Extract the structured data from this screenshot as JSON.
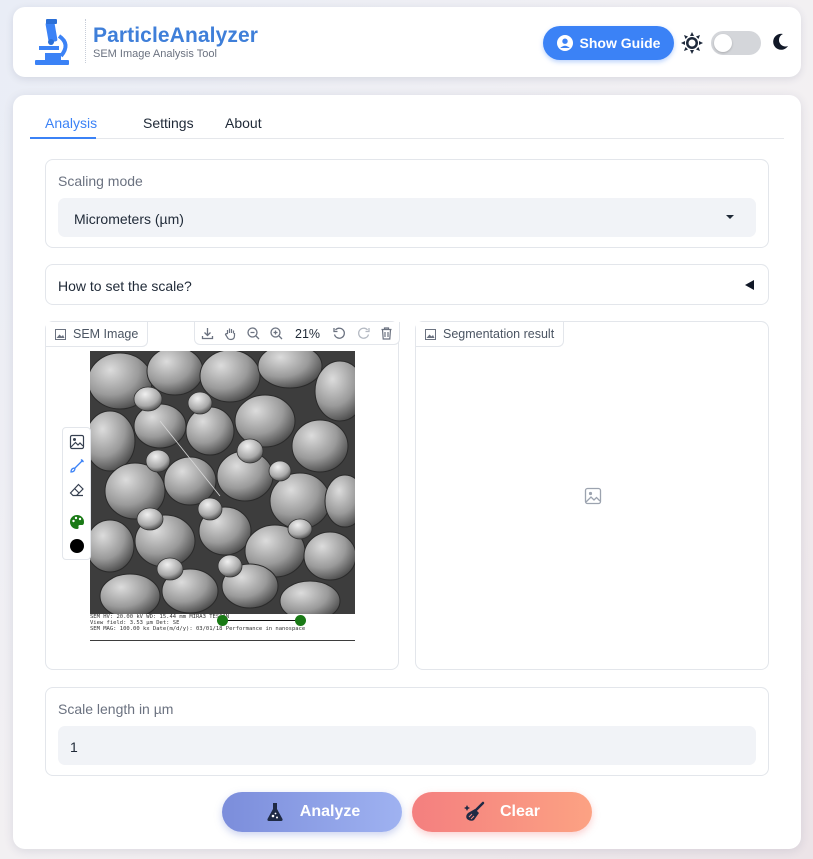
{
  "header": {
    "title": "ParticleAnalyzer",
    "subtitle": "SEM Image Analysis Tool",
    "guide_button": "Show Guide",
    "theme_toggle_on": false
  },
  "tabs": [
    {
      "label": "Analysis",
      "active": true
    },
    {
      "label": "Settings",
      "active": false
    },
    {
      "label": "About",
      "active": false
    }
  ],
  "scaling": {
    "label": "Scaling mode",
    "selected": "Micrometers (µm)"
  },
  "accordion": {
    "label": "How to set the scale?"
  },
  "sem_panel": {
    "label": "SEM Image",
    "zoom": "21%",
    "info_line1": "SEM HV: 20.00 kV    WD: 15.44 mm                    MIRA3 TESCAN",
    "info_line2": "View field: 3.53 µm  Det: SE",
    "info_line3": "SEM MAG: 100.00 kx  Date(m/d/y): 03/01/18       Performance in nanospace"
  },
  "seg_panel": {
    "label": "Segmentation result"
  },
  "scale_length": {
    "label": "Scale length in µm",
    "value": "1"
  },
  "actions": {
    "analyze": "Analyze",
    "clear": "Clear"
  },
  "colors": {
    "accent": "#3b82f6",
    "title_blue": "#3f7fd9",
    "marker_green": "#1a7a16"
  }
}
